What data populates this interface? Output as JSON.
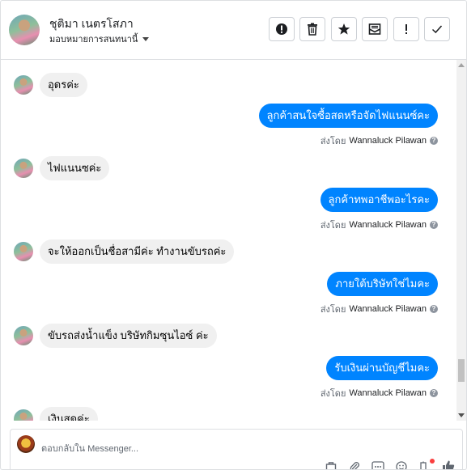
{
  "header": {
    "name": "ชุติมา เนตรโสภา",
    "assign_label": "มอบหมายการสนทนานี้",
    "toolbar": [
      {
        "name": "spam-button",
        "icon": "alert-circle-icon"
      },
      {
        "name": "delete-button",
        "icon": "trash-icon"
      },
      {
        "name": "star-button",
        "icon": "star-icon"
      },
      {
        "name": "mark-unread-button",
        "icon": "envelope-icon"
      },
      {
        "name": "follow-up-button",
        "icon": "exclamation-icon"
      },
      {
        "name": "mark-done-button",
        "icon": "checkmark-icon"
      }
    ]
  },
  "messages": [
    {
      "dir": "in",
      "text": "อุดรค่ะ"
    },
    {
      "dir": "out",
      "text": "ลูกค้าสนใจซื้อสดหรือจัดไฟแนนซ์คะ",
      "sent_by_label": "ส่งโดย",
      "sender": "Wannaluck Pilawan"
    },
    {
      "dir": "in",
      "text": "ไฟแนนซค่ะ"
    },
    {
      "dir": "out",
      "text": "ลูกค้าทพอาชีพอะไรคะ",
      "sent_by_label": "ส่งโดย",
      "sender": "Wannaluck Pilawan"
    },
    {
      "dir": "in",
      "text": "จะให้ออกเป็นชื่อสามีค่ะ ทำงานขับรถค่ะ"
    },
    {
      "dir": "out",
      "text": "ภายใต้บริษัทใช่ไมคะ",
      "sent_by_label": "ส่งโดย",
      "sender": "Wannaluck Pilawan"
    },
    {
      "dir": "in",
      "text": "ขับรถส่งน้ำแข็ง บริษัทกิมซุนไอซ์ ค่ะ"
    },
    {
      "dir": "out",
      "text": "รับเงินผ่านบัญชีไมคะ",
      "sent_by_label": "ส่งโดย",
      "sender": "Wannaluck Pilawan"
    },
    {
      "dir": "in",
      "text": "เงินสดค่ะ"
    }
  ],
  "composer": {
    "placeholder": "ตอบกลับใน Messenger..."
  },
  "colors": {
    "outgoing_bubble": "#0084ff",
    "incoming_bubble": "#f0f0f0",
    "notification_dot": "#fa3e3e"
  }
}
